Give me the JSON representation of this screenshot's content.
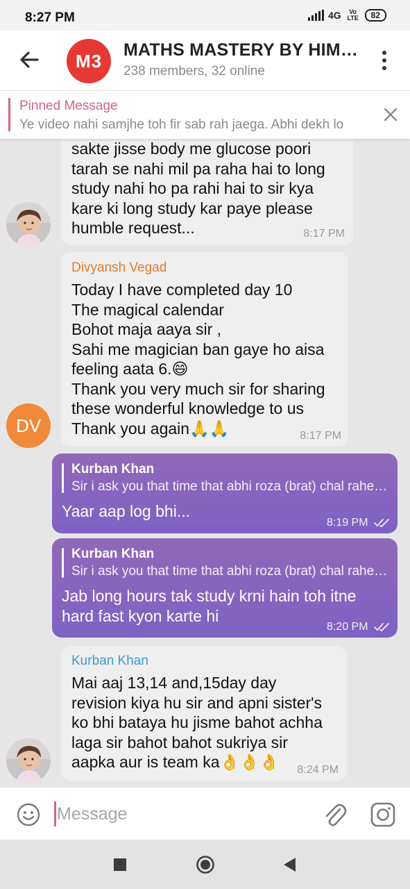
{
  "status_bar": {
    "time": "8:27 PM",
    "network": "4G",
    "volte": "Vo LTE",
    "battery": "82"
  },
  "header": {
    "avatar_text": "M3",
    "title": "MATHS MASTERY BY HIMANSHU",
    "subtitle": "238 members, 32 online"
  },
  "pinned": {
    "label": "Pinned Message",
    "text": "Ye video nahi samjhe toh fir sab rah jaega. Abhi dekh lo"
  },
  "messages": [
    {
      "direction": "incoming",
      "sender": "",
      "lines": [
        "sakte jisse body me glucose poori",
        "tarah se nahi mil pa raha hai to long",
        "study  nahi ho pa rahi hai to sir kya",
        "kare ki long study kar paye please",
        "humble request..."
      ],
      "time": "8:17 PM"
    },
    {
      "direction": "incoming",
      "sender": "Divyansh Vegad",
      "sender_color": "#e07b2c",
      "avatar_text": "DV",
      "lines": [
        "Today I have completed day 10",
        "The magical calendar",
        "Bohot maja aaya sir ,",
        "Sahi me magician ban gaye ho aisa",
        "feeling aata 6.😄",
        "Thank you very much sir for sharing",
        "these wonderful knowledge to us",
        "Thank you again🙏🙏"
      ],
      "time": "8:17 PM"
    },
    {
      "direction": "outgoing",
      "reply_name": "Kurban Khan",
      "reply_text": "Sir i ask you that time that abhi roza (brat) chal rahe hai",
      "lines": [
        "Yaar aap log bhi..."
      ],
      "time": "8:19 PM"
    },
    {
      "direction": "outgoing",
      "reply_name": "Kurban Khan",
      "reply_text": "Sir i ask you that time that abhi roza (brat) chal rahe hai",
      "lines": [
        "Jab long hours tak study krni hain toh itne",
        "hard fast kyon karte hi"
      ],
      "time": "8:20 PM"
    },
    {
      "direction": "incoming",
      "sender": "Kurban Khan",
      "sender_color": "#3a9cc9",
      "lines": [
        "Mai aaj 13,14 and,15day day",
        "revision kiya hu sir and apni sister's",
        "ko bhi bataya hu jisme bahot achha",
        "laga sir bahot bahot sukriya sir",
        "aapka aur is team ka👌👌👌"
      ],
      "time": "8:24 PM"
    }
  ],
  "input": {
    "placeholder": "Message"
  },
  "colors": {
    "accent": "#d36486",
    "outgoing_bubble": "#8a66bf",
    "avatar_m3": "#e53935",
    "avatar_dv": "#f08a3a"
  },
  "icons": [
    "back-arrow-icon",
    "more-vert-icon",
    "close-icon",
    "emoji-icon",
    "attach-icon",
    "camera-icon",
    "nav-recents-icon",
    "nav-home-icon",
    "nav-back-icon",
    "double-check-icon"
  ]
}
